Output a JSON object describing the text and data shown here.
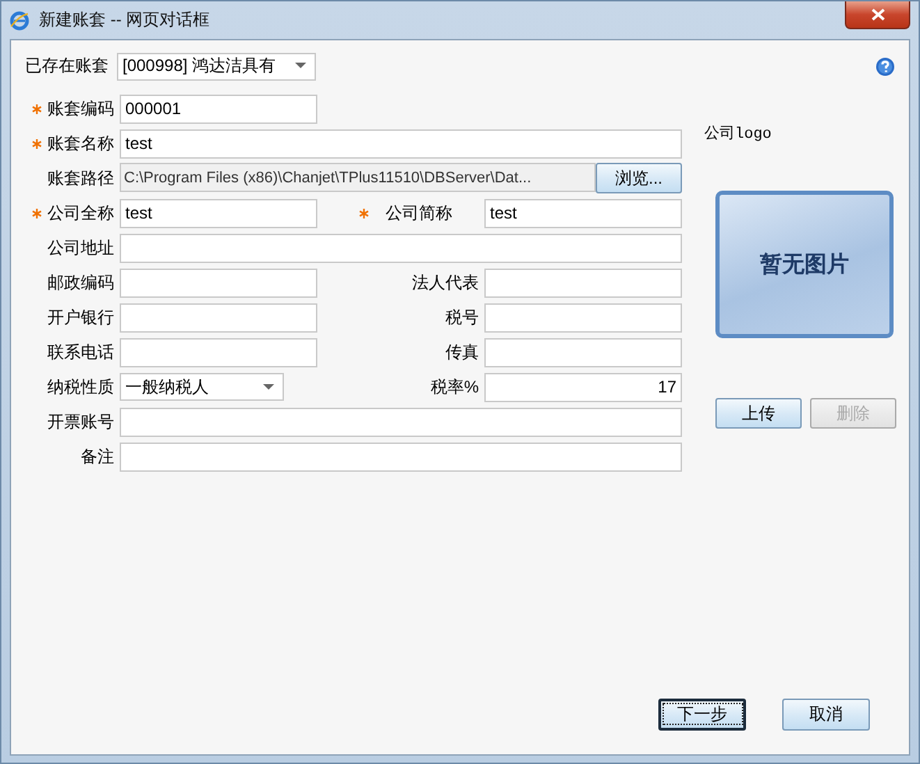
{
  "window": {
    "title": "新建账套 -- 网页对话框"
  },
  "existing": {
    "label": "已存在账套",
    "value": "[000998] 鸿达洁具有"
  },
  "rows": [
    {
      "fields": [
        {
          "label": "账套编码",
          "value": "000001",
          "required": true,
          "kind": "text"
        }
      ]
    },
    {
      "fields": [
        {
          "label": "账套名称",
          "value": "test",
          "required": true,
          "kind": "wide"
        }
      ]
    },
    {
      "fields": [
        {
          "label": "账套路径",
          "value": "C:\\Program Files (x86)\\Chanjet\\TPlus11510\\DBServer\\Dat...",
          "required": false,
          "kind": "path",
          "button": "浏览..."
        }
      ]
    },
    {
      "fields": [
        {
          "label": "公司全称",
          "value": "test",
          "required": true,
          "kind": "text"
        },
        {
          "label": "公司简称",
          "value": "test",
          "required": true,
          "kind": "text"
        }
      ]
    },
    {
      "fields": [
        {
          "label": "公司地址",
          "required": false,
          "kind": "wide"
        }
      ]
    },
    {
      "fields": [
        {
          "label": "邮政编码",
          "required": false,
          "kind": "text"
        },
        {
          "label": "法人代表",
          "required": false,
          "kind": "text"
        }
      ]
    },
    {
      "fields": [
        {
          "label": "开户银行",
          "required": false,
          "kind": "text"
        },
        {
          "label": "税号",
          "required": false,
          "kind": "text"
        }
      ]
    },
    {
      "fields": [
        {
          "label": "联系电话",
          "required": false,
          "kind": "text"
        },
        {
          "label": "传真",
          "required": false,
          "kind": "text"
        }
      ]
    },
    {
      "fields": [
        {
          "label": "纳税性质",
          "value": "一般纳税人",
          "required": false,
          "kind": "select"
        },
        {
          "label": "税率%",
          "value": "17",
          "required": false,
          "kind": "number"
        }
      ]
    },
    {
      "fields": [
        {
          "label": "开票账号",
          "required": false,
          "kind": "wide"
        }
      ]
    },
    {
      "fields": [
        {
          "label": "备注",
          "required": false,
          "kind": "wide"
        }
      ]
    }
  ],
  "logo": {
    "label": "公司logo",
    "placeholder_text": "暂无图片",
    "buttons": [
      {
        "label": "上传",
        "disabled": false
      },
      {
        "label": "删除",
        "disabled": true
      }
    ]
  },
  "footer_buttons": [
    {
      "label": "下一步",
      "default": true
    },
    {
      "label": "取消",
      "default": false
    }
  ]
}
